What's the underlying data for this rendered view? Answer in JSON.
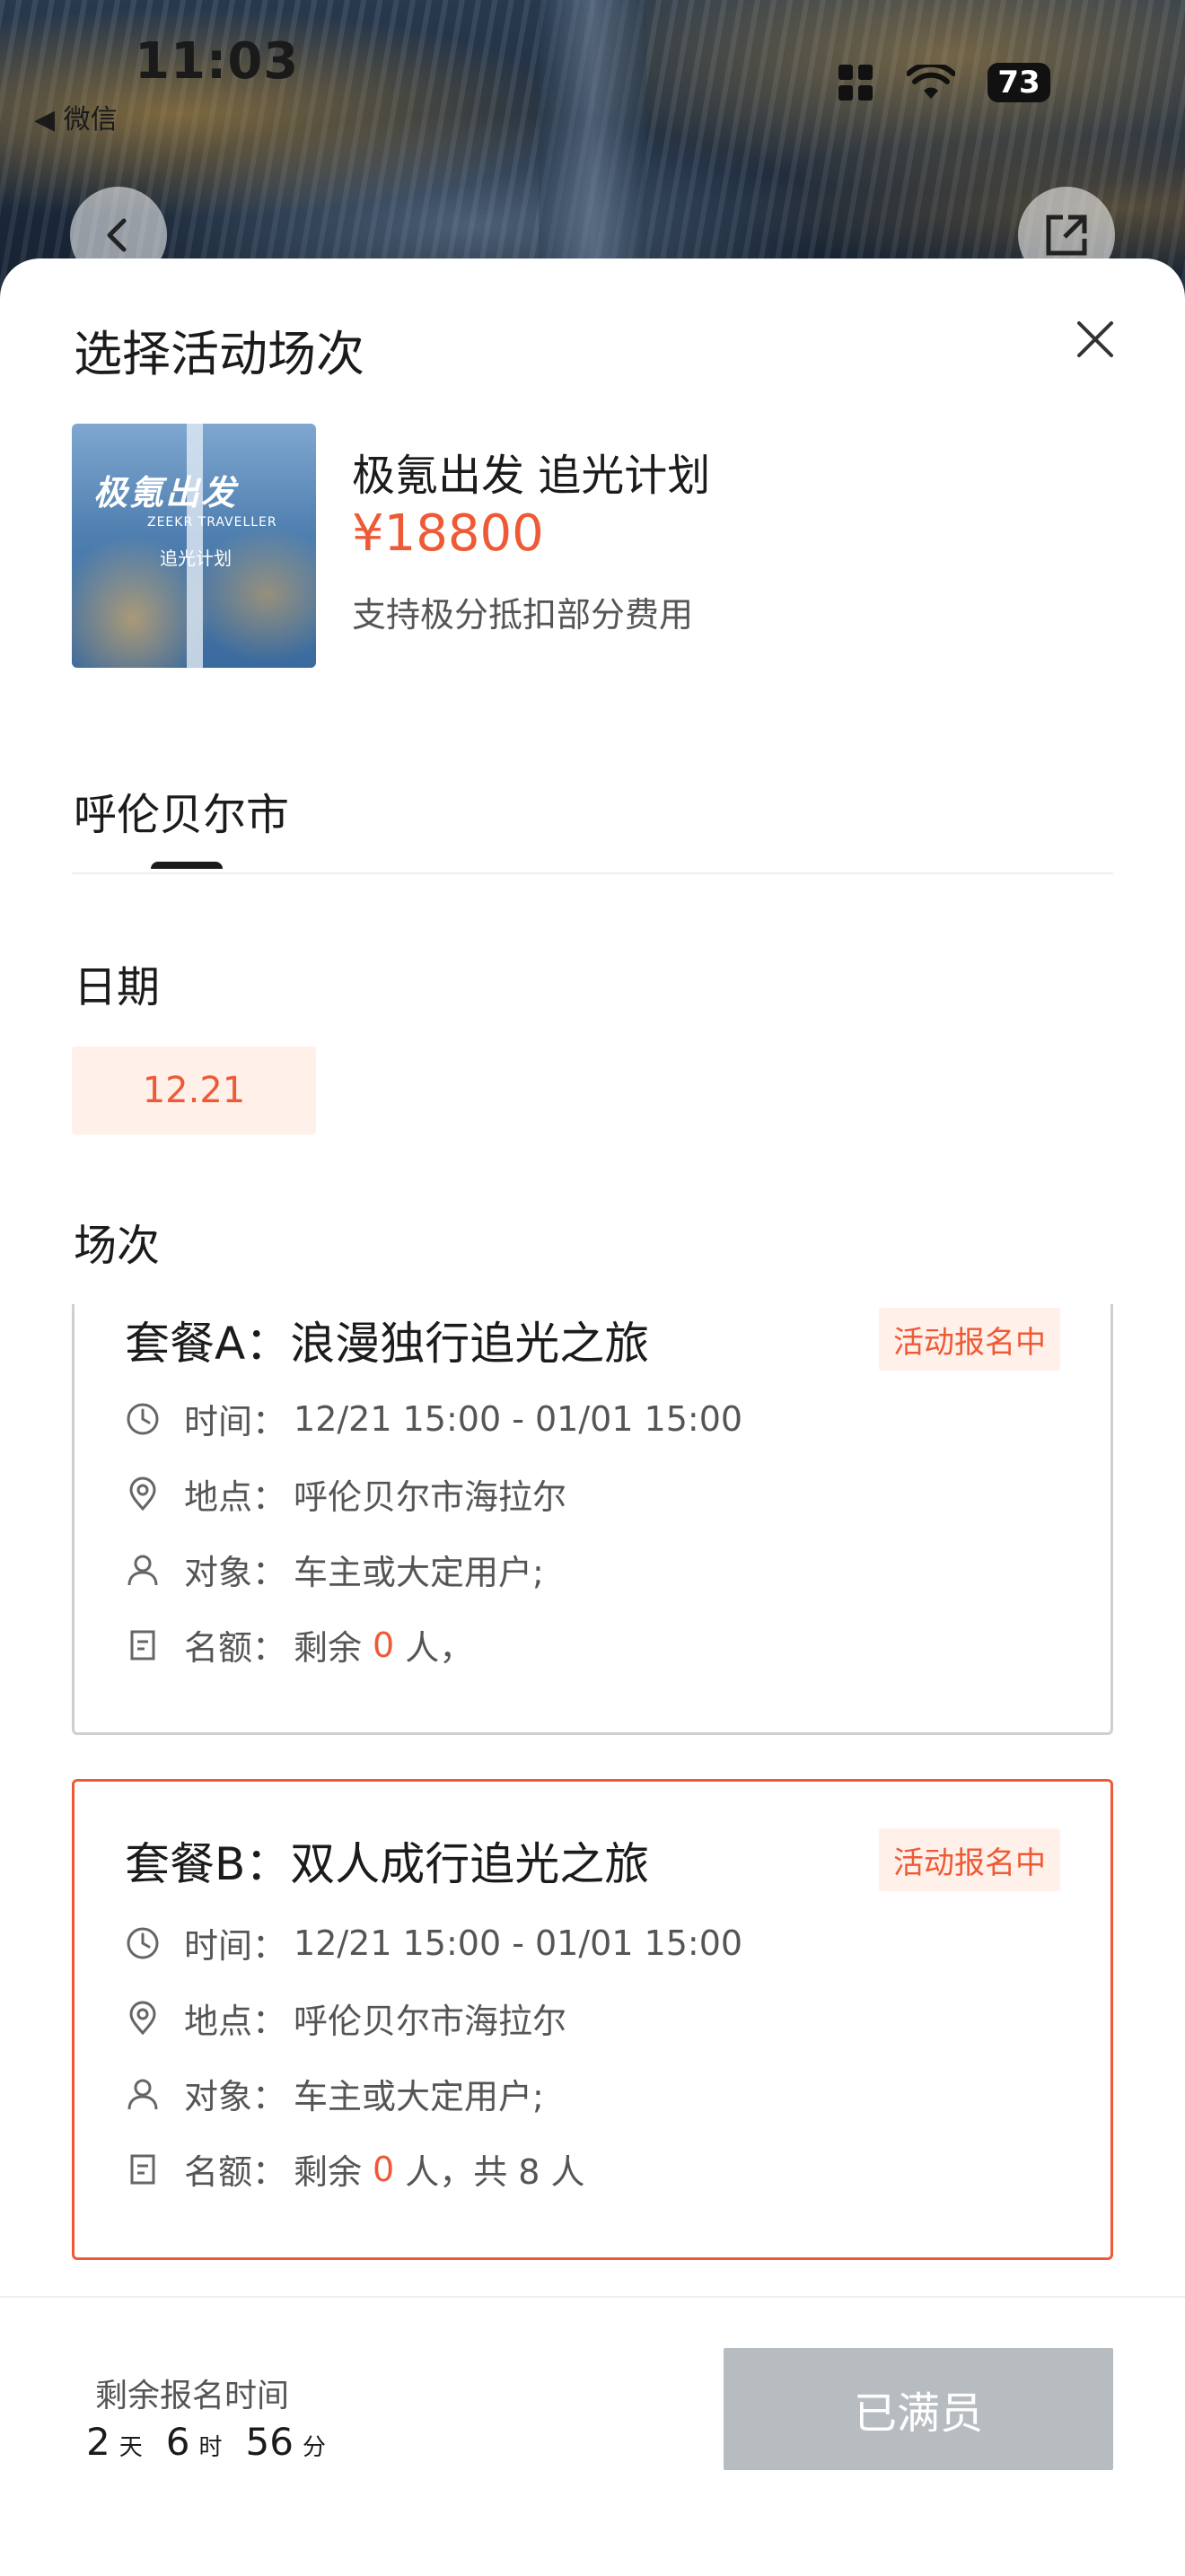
{
  "status_bar": {
    "time": "11:03",
    "back_app": "◀ 微信",
    "battery": "73"
  },
  "sheet": {
    "title": "选择活动场次"
  },
  "product": {
    "thumb_title": "极氪出发",
    "thumb_en": "ZEEKR TRAVELLER",
    "thumb_sub": "追光计划",
    "name": "极氪出发 追光计划",
    "price": "¥18800",
    "note": "支持极分抵扣部分费用"
  },
  "city": {
    "label": "呼伦贝尔市"
  },
  "date_section": {
    "label": "日期",
    "selected": "12.21"
  },
  "session_section": {
    "label": "场次"
  },
  "packages": [
    {
      "title": "套餐A：浪漫独行追光之旅",
      "badge": "活动报名中",
      "time_key": "时间：",
      "time": "12/21 15:00 - 01/01 15:00",
      "place_key": "地点：",
      "place": "呼伦贝尔市海拉尔",
      "target_key": "对象：",
      "target": "车主或大定用户;",
      "quota_key": "名额：",
      "quota_pre": "剩余",
      "quota_num": "0",
      "quota_post": "人，"
    },
    {
      "title": "套餐B：双人成行追光之旅",
      "badge": "活动报名中",
      "time_key": "时间：",
      "time": "12/21 15:00 - 01/01 15:00",
      "place_key": "地点：",
      "place": "呼伦贝尔市海拉尔",
      "target_key": "对象：",
      "target": "车主或大定用户;",
      "quota_key": "名额：",
      "quota_pre": "剩余",
      "quota_num": "0",
      "quota_post": "人，共 8 人"
    }
  ],
  "footer": {
    "remaining_label": "剩余报名时间",
    "days": "2",
    "days_unit": "天",
    "hours": "6",
    "hours_unit": "时",
    "minutes": "56",
    "minutes_unit": "分",
    "button_label": "已满员"
  },
  "colors": {
    "accent": "#ee5a36",
    "accent_bg": "#fff0ea",
    "disabled_button": "#b7bcc0"
  },
  "icons": [
    "signal-icon",
    "wifi-icon",
    "battery-icon",
    "back-arrow-icon",
    "share-icon",
    "close-icon",
    "clock-icon",
    "location-pin-icon",
    "person-icon",
    "clipboard-icon"
  ]
}
